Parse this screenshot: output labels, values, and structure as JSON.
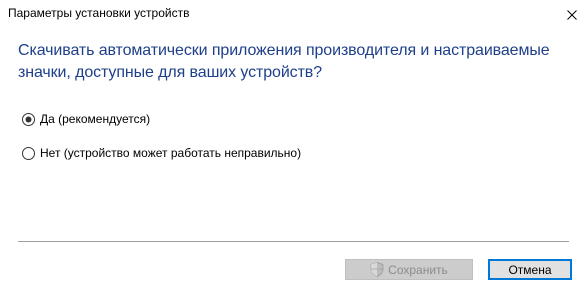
{
  "window": {
    "title": "Параметры установки устройств"
  },
  "question": "Скачивать автоматически приложения производителя и настраиваемые значки, доступные для ваших устройств?",
  "options": [
    {
      "label": "Да (рекомендуется)",
      "selected": true
    },
    {
      "label": "Нет (устройство может работать неправильно)",
      "selected": false
    }
  ],
  "buttons": {
    "save_label": "Сохранить",
    "save_enabled": false,
    "cancel_label": "Отмена"
  },
  "colors": {
    "question_text": "#1e3f8a",
    "focus_border": "#0078d7"
  },
  "icons": {
    "close": "close-icon",
    "shield": "uac-shield-icon"
  }
}
